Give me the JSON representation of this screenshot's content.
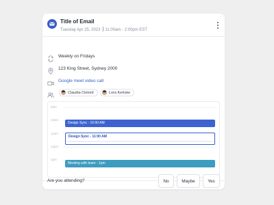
{
  "email": {
    "title": "Title of Email",
    "date": "Tuesday Apr 25, 2023",
    "time_range": "11:00am - 2:00pm EST"
  },
  "details": {
    "recurrence": "Weekly on Fridays",
    "location": "123 King Street, Sydney 2000",
    "meeting_link": "Google meet video call",
    "attendees": [
      "Claudia Clelord",
      "Lora Kerluke"
    ]
  },
  "calendar": {
    "times": [
      "9am",
      "10am",
      "11am",
      "12pm",
      "1pm"
    ],
    "events": [
      {
        "label": "Design Sync - 10:00 AM"
      },
      {
        "label": "Design Sync - 11:00 AM"
      },
      {
        "label": "Meeting with team - 1pm"
      }
    ]
  },
  "rsvp": {
    "question": "Are you attending?",
    "no": "No",
    "maybe": "Maybe",
    "yes": "Yes"
  },
  "colors": {
    "accent": "#3a5cc4",
    "event_blue": "#3d63d2",
    "event_teal": "#3d9cc0",
    "link": "#2f61c7"
  },
  "icons": {
    "header": "mail-icon",
    "menu": "more-vertical-icon",
    "recurrence": "repeat-icon",
    "location": "map-pin-icon",
    "video": "video-icon",
    "attendees": "users-icon"
  }
}
